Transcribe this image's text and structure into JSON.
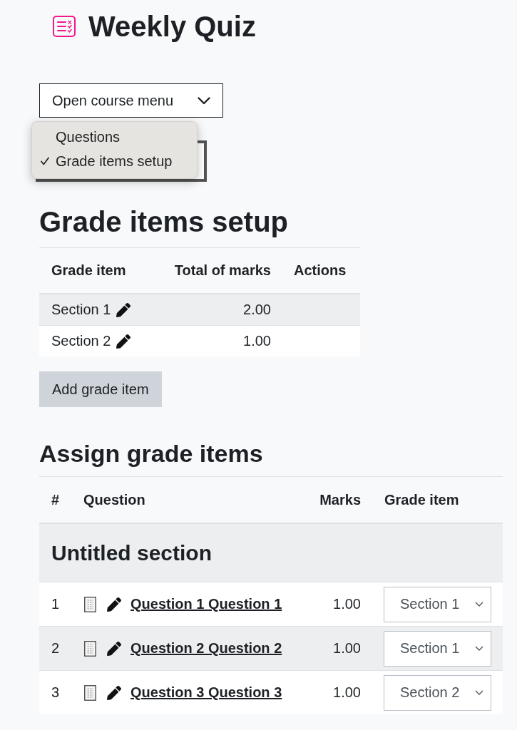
{
  "page": {
    "title": "Weekly Quiz"
  },
  "course_menu": {
    "label": "Open course menu",
    "popup": {
      "items": [
        {
          "label": "Questions",
          "selected": false
        },
        {
          "label": "Grade items setup",
          "selected": true
        }
      ]
    }
  },
  "grade_items": {
    "heading": "Grade items setup",
    "columns": [
      "Grade item",
      "Total of marks",
      "Actions"
    ],
    "rows": [
      {
        "name": "Section 1",
        "total": "2.00"
      },
      {
        "name": "Section 2",
        "total": "1.00"
      }
    ],
    "add_button": "Add grade item"
  },
  "assign": {
    "heading": "Assign grade items",
    "columns": [
      "#",
      "Question",
      "Marks",
      "Grade item"
    ],
    "sections": [
      {
        "title": "Untitled section",
        "questions": [
          {
            "number": "1",
            "name": "Question 1 Question 1",
            "marks": "1.00",
            "grade_item": "Section 1"
          },
          {
            "number": "2",
            "name": "Question 2 Question 2",
            "marks": "1.00",
            "grade_item": "Section 1"
          },
          {
            "number": "3",
            "name": "Question 3 Question 3",
            "marks": "1.00",
            "grade_item": "Section 2"
          }
        ]
      }
    ]
  }
}
